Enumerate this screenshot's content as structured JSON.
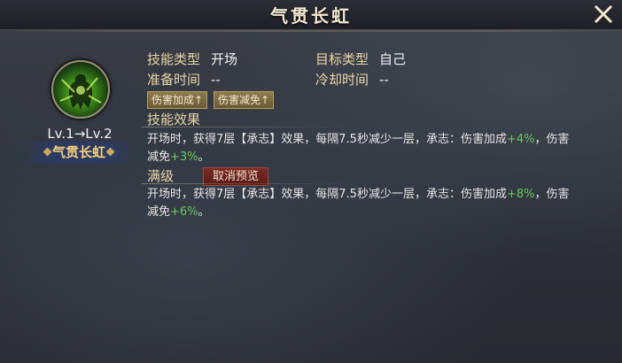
{
  "window": {
    "title": "气贯长虹"
  },
  "skill": {
    "name": "气贯长虹",
    "level_text": "Lv.1→Lv.2",
    "icon": "warrior-green-aura-icon",
    "type_label": "技能类型",
    "type_value": "开场",
    "target_label": "目标类型",
    "target_value": "自己",
    "prep_label": "准备时间",
    "prep_value": "--",
    "cooldown_label": "冷却时间",
    "cooldown_value": "--",
    "tags": [
      "伤害加成↑",
      "伤害减免↑"
    ]
  },
  "effect": {
    "title": "技能效果",
    "line1_a": "开场时，获得7层【承志】效果，每隔7.5秒减少一层，承志：伤害加成",
    "line1_b": "+4%",
    "line1_c": "，伤害",
    "line2_a": "减免",
    "line2_b": "+3%",
    "line2_c": "。"
  },
  "max": {
    "title": "满级",
    "cancel_preview": "取消预览",
    "line1_a": "开场时，获得7层【承志】效果，每隔7.5秒减少一层，承志：伤害加成",
    "line1_b": "+8%",
    "line1_c": "，伤害",
    "line2_a": "减免",
    "line2_b": "+6%",
    "line2_c": "。"
  },
  "colors": {
    "accent_gold": "#e8d6a8",
    "name_gold": "#f5cf7c",
    "bonus_green": "#69c95a",
    "cancel_red": "#7a2a24"
  }
}
